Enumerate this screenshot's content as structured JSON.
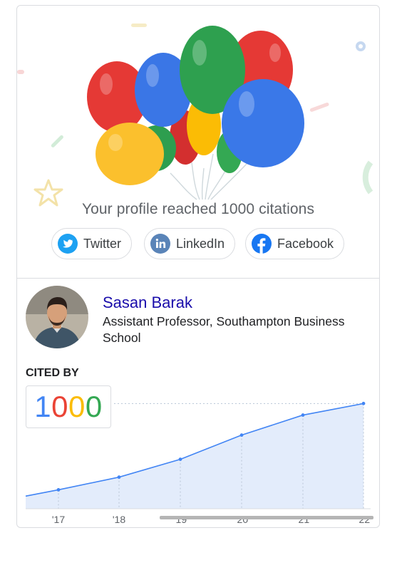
{
  "celebration": {
    "message": "Your profile reached 1000 citations"
  },
  "share": {
    "twitter_label": "Twitter",
    "linkedin_label": "LinkedIn",
    "facebook_label": "Facebook"
  },
  "profile": {
    "name": "Sasan Barak",
    "affiliation": "Assistant Professor, Southampton Business School"
  },
  "cited_by": {
    "label": "CITED BY",
    "digits": [
      "1",
      "0",
      "0",
      "0"
    ],
    "digit_colors": [
      "#4285f4",
      "#ea4335",
      "#fbbc05",
      "#34a853"
    ]
  },
  "colors": {
    "accent_blue": "#4285f4",
    "area_fill": "#e3ecfb",
    "name_link": "#1a0dab"
  },
  "chart_data": {
    "type": "area",
    "x": [
      "'17",
      "'18",
      "'19",
      "'20",
      "'21",
      "'22"
    ],
    "values": [
      180,
      300,
      470,
      700,
      890,
      1000
    ],
    "ylim": [
      0,
      1070
    ],
    "x_partial_start_value": 120,
    "reference_line_value": 1000,
    "grid": "vertical dotted at each year",
    "color": "#4285f4"
  }
}
